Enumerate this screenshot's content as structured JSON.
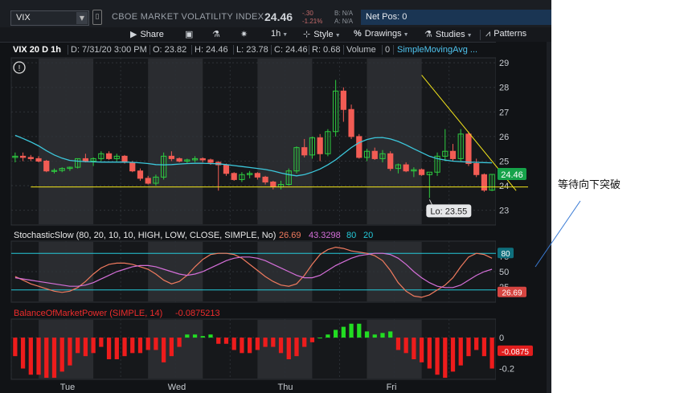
{
  "window": {
    "symbol": "VIX",
    "instrument_name": "CBOE MARKET VOLATILITY INDEX",
    "last_price": "24.46",
    "change": "-.30",
    "change_pct": "-1.21%",
    "bid": "B: N/A",
    "ask": "A: N/A",
    "net_pos": "Net Pos: 0"
  },
  "toolbar": {
    "share": "Share",
    "timeframe": "1h",
    "style": "Style",
    "drawings": "Drawings",
    "studies": "Studies",
    "patterns": "Patterns"
  },
  "infobar": {
    "title": "VIX 20 D 1h",
    "date": "D: 7/31/20 3:00 PM",
    "open": "O: 23.82",
    "high": "H: 24.46",
    "low": "L: 23.78",
    "close": "C: 24.46",
    "range": "R: 0.68",
    "volume": "Volume",
    "volume_value": "0",
    "sma": "SimpleMovingAvg ..."
  },
  "colors": {
    "up": "#2ecc40",
    "down": "#f25c54",
    "sma": "#3cc8dc",
    "trendline": "#f3e51b",
    "stoch_k": "#f07a5e",
    "stoch_d": "#d56fd9",
    "level": "#24c9d9",
    "bop_up": "#22dd22",
    "bop_down": "#ee1c1c"
  },
  "chart_data": [
    {
      "type": "candlestick",
      "yticks": [
        23,
        24,
        25,
        26,
        27,
        28,
        29
      ],
      "ylim": [
        22.4,
        29.2
      ],
      "x_labels": [
        "Tue",
        "Wed",
        "Thu",
        "Fri"
      ],
      "last_value_label": "24.46",
      "low_label": "Lo: 23.55",
      "candles": [
        [
          25.15,
          25.35,
          24.95,
          25.2
        ],
        [
          25.2,
          25.35,
          25.0,
          25.15
        ],
        [
          25.15,
          25.25,
          25.0,
          25.1
        ],
        [
          25.1,
          25.2,
          24.95,
          25.0
        ],
        [
          25.0,
          25.05,
          24.55,
          24.6
        ],
        [
          24.6,
          24.7,
          24.5,
          24.62
        ],
        [
          24.62,
          24.75,
          24.55,
          24.7
        ],
        [
          24.7,
          24.78,
          24.6,
          24.75
        ],
        [
          24.75,
          25.1,
          24.7,
          25.1
        ],
        [
          25.1,
          25.3,
          24.95,
          25.0
        ],
        [
          25.0,
          25.15,
          24.8,
          25.1
        ],
        [
          25.1,
          25.4,
          25.0,
          25.3
        ],
        [
          25.3,
          25.4,
          25.05,
          25.1
        ],
        [
          25.1,
          25.3,
          25.0,
          25.2
        ],
        [
          25.2,
          25.25,
          24.9,
          24.95
        ],
        [
          24.95,
          25.0,
          24.55,
          24.6
        ],
        [
          24.6,
          24.7,
          24.2,
          24.3
        ],
        [
          24.3,
          24.4,
          24.05,
          24.1
        ],
        [
          24.1,
          24.45,
          24.0,
          24.35
        ],
        [
          24.35,
          25.35,
          24.25,
          25.2
        ],
        [
          25.2,
          25.4,
          25.0,
          25.1
        ],
        [
          25.1,
          25.15,
          24.95,
          25.0
        ],
        [
          25.0,
          25.1,
          24.9,
          25.05
        ],
        [
          25.05,
          25.2,
          24.95,
          25.1
        ],
        [
          25.1,
          25.15,
          24.95,
          25.05
        ],
        [
          25.05,
          25.1,
          24.85,
          24.95
        ],
        [
          24.95,
          25.0,
          23.8,
          24.85
        ],
        [
          24.85,
          24.9,
          24.4,
          24.5
        ],
        [
          24.5,
          24.55,
          24.2,
          24.25
        ],
        [
          24.25,
          24.55,
          24.15,
          24.45
        ],
        [
          24.45,
          24.6,
          24.3,
          24.5
        ],
        [
          24.5,
          24.55,
          24.25,
          24.35
        ],
        [
          24.35,
          24.4,
          24.05,
          24.15
        ],
        [
          24.15,
          24.2,
          23.85,
          23.95
        ],
        [
          23.95,
          24.2,
          23.85,
          24.05
        ],
        [
          24.05,
          24.7,
          24.0,
          24.6
        ],
        [
          24.6,
          25.6,
          24.5,
          25.55
        ],
        [
          25.55,
          25.9,
          25.15,
          25.25
        ],
        [
          25.25,
          26.0,
          25.1,
          25.95
        ],
        [
          25.95,
          26.1,
          25.0,
          25.3
        ],
        [
          25.3,
          26.3,
          25.2,
          26.2
        ],
        [
          26.2,
          28.3,
          26.0,
          27.85
        ],
        [
          27.85,
          28.0,
          26.6,
          27.1
        ],
        [
          27.1,
          27.3,
          25.9,
          26.0
        ],
        [
          26.0,
          26.1,
          25.1,
          25.15
        ],
        [
          25.15,
          25.5,
          25.0,
          25.4
        ],
        [
          25.4,
          25.55,
          25.05,
          25.1
        ],
        [
          25.1,
          25.45,
          24.95,
          25.3
        ],
        [
          25.3,
          25.4,
          24.6,
          24.7
        ],
        [
          24.7,
          24.9,
          24.5,
          24.85
        ],
        [
          24.85,
          24.95,
          24.55,
          24.6
        ],
        [
          24.6,
          24.75,
          24.35,
          24.65
        ],
        [
          24.65,
          24.7,
          24.4,
          24.45
        ],
        [
          24.45,
          24.5,
          23.5,
          24.55
        ],
        [
          24.55,
          25.35,
          24.4,
          25.2
        ],
        [
          25.2,
          26.3,
          25.0,
          25.4
        ],
        [
          25.4,
          25.7,
          25.0,
          25.1
        ],
        [
          25.1,
          26.3,
          25.0,
          26.1
        ],
        [
          26.1,
          26.2,
          24.8,
          24.9
        ],
        [
          24.9,
          25.1,
          24.35,
          24.45
        ],
        [
          24.45,
          24.5,
          23.75,
          23.82
        ],
        [
          23.82,
          24.46,
          23.78,
          24.46
        ]
      ],
      "sma": [
        26.05,
        25.92,
        25.78,
        25.62,
        25.42,
        25.25,
        25.12,
        25.03,
        25.0,
        24.98,
        24.97,
        24.96,
        24.96,
        24.96,
        24.96,
        24.95,
        24.93,
        24.9,
        24.86,
        24.85,
        24.86,
        24.88,
        24.9,
        24.91,
        24.91,
        24.9,
        24.89,
        24.86,
        24.82,
        24.78,
        24.74,
        24.7,
        24.66,
        24.6,
        24.52,
        24.45,
        24.4,
        24.45,
        24.55,
        24.68,
        24.85,
        25.05,
        25.3,
        25.55,
        25.75,
        25.88,
        25.95,
        25.96,
        25.9,
        25.8,
        25.66,
        25.5,
        25.35,
        25.2,
        25.1,
        25.04,
        25.0,
        24.98,
        24.96,
        24.95,
        24.94,
        24.93
      ],
      "trendline": {
        "from": [
          52,
          28.5
        ],
        "to": [
          61,
          23.95
        ]
      },
      "support": 23.95
    },
    {
      "type": "line",
      "title": "StochasticSlow (80, 20, 10, 10, HIGH, LOW, CLOSE, SIMPLE, No)",
      "values_shown": [
        "26.69",
        "43.3298",
        "80",
        "20"
      ],
      "ylim": [
        0,
        100
      ],
      "yticks": [
        20,
        50,
        80
      ],
      "levels": [
        80,
        20
      ],
      "last_label": "26.69",
      "level_label": "80",
      "tick_labels": [
        "75",
        "50",
        "25"
      ],
      "series": [
        {
          "values": [
            42,
            36,
            30,
            26,
            22,
            18,
            16,
            18,
            24,
            34,
            46,
            56,
            62,
            64,
            64,
            62,
            58,
            54,
            46,
            36,
            30,
            34,
            44,
            58,
            70,
            78,
            80,
            80,
            78,
            72,
            62,
            52,
            42,
            34,
            28,
            26,
            30,
            44,
            62,
            78,
            86,
            90,
            88,
            84,
            82,
            80,
            76,
            68,
            52,
            32,
            18,
            10,
            8,
            12,
            20,
            28,
            40,
            58,
            74,
            80,
            78,
            72
          ]
        },
        {
          "values": [
            40,
            38,
            36,
            34,
            32,
            30,
            28,
            26,
            26,
            28,
            32,
            38,
            44,
            50,
            54,
            58,
            60,
            60,
            58,
            54,
            50,
            46,
            44,
            46,
            50,
            56,
            62,
            68,
            72,
            74,
            74,
            72,
            68,
            62,
            56,
            50,
            44,
            40,
            40,
            44,
            52,
            60,
            66,
            72,
            76,
            78,
            80,
            80,
            78,
            72,
            62,
            50,
            40,
            32,
            26,
            24,
            24,
            28,
            36,
            44,
            50,
            54
          ]
        }
      ]
    },
    {
      "type": "bar",
      "title": "BalanceOfMarketPower (SIMPLE, 14)",
      "value_shown": "-0.0875213",
      "ylim": [
        -0.27,
        0.12
      ],
      "yticks": [
        0,
        -0.2
      ],
      "tick_labels": [
        "0",
        "-0.2"
      ],
      "last_label": "-0.0875",
      "values": [
        -0.12,
        -0.2,
        -0.24,
        -0.24,
        -0.26,
        -0.26,
        -0.22,
        -0.18,
        -0.1,
        -0.12,
        -0.1,
        -0.06,
        -0.14,
        -0.14,
        -0.12,
        -0.1,
        -0.1,
        -0.08,
        -0.08,
        -0.16,
        -0.12,
        -0.06,
        0.02,
        0.02,
        0.01,
        0.02,
        -0.04,
        -0.04,
        -0.08,
        -0.1,
        -0.1,
        -0.08,
        -0.06,
        -0.06,
        -0.1,
        -0.14,
        -0.12,
        -0.06,
        -0.03,
        0.0,
        0.02,
        0.05,
        0.07,
        0.09,
        0.09,
        0.04,
        0.02,
        0.03,
        0.04,
        -0.08,
        -0.1,
        -0.14,
        -0.16,
        -0.2,
        -0.24,
        -0.26,
        -0.22,
        -0.18,
        -0.12,
        -0.08,
        -0.12,
        -0.2
      ]
    }
  ],
  "annotation": {
    "text": "等待向下突破"
  }
}
